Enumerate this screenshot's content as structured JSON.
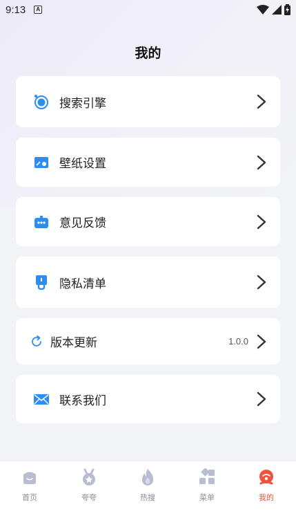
{
  "status_bar": {
    "time": "9:13",
    "notification_badge": "A"
  },
  "header": {
    "title": "我的"
  },
  "menu": {
    "items": [
      {
        "label": "搜索引擎",
        "icon": "search-engine-icon",
        "value": ""
      },
      {
        "label": "壁纸设置",
        "icon": "wallpaper-icon",
        "value": ""
      },
      {
        "label": "意见反馈",
        "icon": "feedback-icon",
        "value": ""
      },
      {
        "label": "隐私清单",
        "icon": "privacy-icon",
        "value": ""
      },
      {
        "label": "版本更新",
        "icon": "refresh-icon",
        "value": "1.0.0"
      },
      {
        "label": "联系我们",
        "icon": "mail-icon",
        "value": ""
      }
    ]
  },
  "tabs": [
    {
      "label": "首页",
      "icon": "home-icon",
      "active": false
    },
    {
      "label": "夸夸",
      "icon": "medal-icon",
      "active": false
    },
    {
      "label": "热搜",
      "icon": "flame-icon",
      "active": false
    },
    {
      "label": "菜单",
      "icon": "grid-icon",
      "active": false
    },
    {
      "label": "我的",
      "icon": "profile-icon",
      "active": true
    }
  ],
  "colors": {
    "accent": "#f0523f",
    "icon_blue": "#2f8cf0",
    "inactive": "#b9bdd2"
  }
}
